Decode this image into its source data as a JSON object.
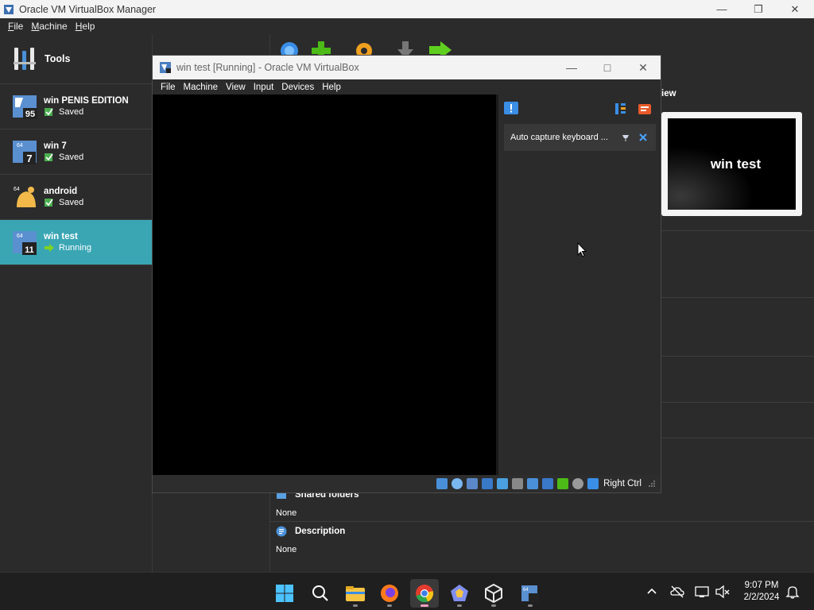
{
  "manager": {
    "title": "Oracle VM VirtualBox Manager",
    "menu": [
      "File",
      "Machine",
      "Help"
    ],
    "window_controls": [
      "minimize",
      "maximize",
      "close"
    ]
  },
  "sidebar": {
    "tools_label": "Tools",
    "vms": [
      {
        "name": "win PENIS EDITION",
        "state": "Saved",
        "badge": "95",
        "os": "windows-95-icon"
      },
      {
        "name": "win 7",
        "state": "Saved",
        "badge": "7",
        "os": "windows-7-icon"
      },
      {
        "name": "android",
        "state": "Saved",
        "badge": "",
        "os": "android-icon"
      },
      {
        "name": "win test",
        "state": "Running",
        "badge": "11",
        "os": "windows-11-icon",
        "selected": true
      }
    ]
  },
  "details": {
    "preview_label": "iew",
    "preview_text": "win test",
    "shared_folders_label": "Shared folders",
    "shared_folders_value": "None",
    "description_label": "Description",
    "description_value": "None"
  },
  "vm_window": {
    "title": "win test [Running] - Oracle VM VirtualBox",
    "menu": [
      "File",
      "Machine",
      "View",
      "Input",
      "Devices",
      "Help"
    ],
    "notice_text": "Auto capture keyboard ...",
    "host_key": "Right Ctrl"
  },
  "taskbar": {
    "time": "9:07 PM",
    "date": "2/2/2024",
    "apps": [
      "start-icon",
      "search-icon",
      "file-explorer-icon",
      "firefox-icon",
      "chrome-icon",
      "app-icon",
      "virtualbox-icon",
      "vm-icon"
    ]
  },
  "colors": {
    "selection": "#3aa6b4",
    "background": "#2b2b2b",
    "titlebar": "#f3f3f3"
  }
}
